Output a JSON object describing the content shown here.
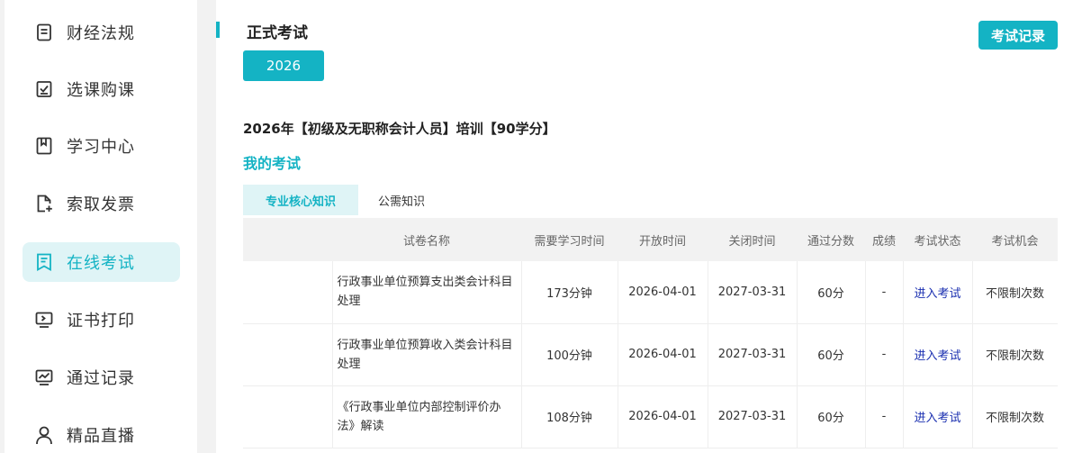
{
  "sidebar": {
    "items": [
      {
        "label": "财经法规",
        "icon": "document-icon"
      },
      {
        "label": "选课购课",
        "icon": "checkbox-icon"
      },
      {
        "label": "学习中心",
        "icon": "bookmark-icon"
      },
      {
        "label": "索取发票",
        "icon": "file-add-icon"
      },
      {
        "label": "在线考试",
        "icon": "exam-icon"
      },
      {
        "label": "证书打印",
        "icon": "certificate-icon"
      },
      {
        "label": "通过记录",
        "icon": "chart-icon"
      },
      {
        "label": "精品直播",
        "icon": "user-icon"
      }
    ],
    "active_index": 4
  },
  "main": {
    "title": "正式考试",
    "record_button": "考试记录",
    "year_button": "2026",
    "course_title": "2026年【初级及无职称会计人员】培训【90学分】",
    "my_exam": "我的考试",
    "tabs": [
      {
        "label": "专业核心知识",
        "active": true
      },
      {
        "label": "公需知识",
        "active": false
      }
    ]
  },
  "table": {
    "headers": [
      "",
      "试卷名称",
      "需要学习时间",
      "开放时间",
      "关闭时间",
      "通过分数",
      "成绩",
      "考试状态",
      "考试机会"
    ],
    "rows": [
      {
        "name": "行政事业单位预算支出类会计科目处理",
        "study_time": "173分钟",
        "open": "2026-04-01",
        "close": "2027-03-31",
        "pass": "60分",
        "score": "-",
        "status": "进入考试",
        "chance": "不限制次数"
      },
      {
        "name": "行政事业单位预算收入类会计科目处理",
        "study_time": "100分钟",
        "open": "2026-04-01",
        "close": "2027-03-31",
        "pass": "60分",
        "score": "-",
        "status": "进入考试",
        "chance": "不限制次数"
      },
      {
        "name": "《行政事业单位内部控制评价办法》解读",
        "study_time": "108分钟",
        "open": "2026-04-01",
        "close": "2027-03-31",
        "pass": "60分",
        "score": "-",
        "status": "进入考试",
        "chance": "不限制次数"
      }
    ]
  },
  "colors": {
    "accent": "#14b3c4",
    "accent_light": "#dff4f6",
    "link": "#1a2fb0"
  }
}
